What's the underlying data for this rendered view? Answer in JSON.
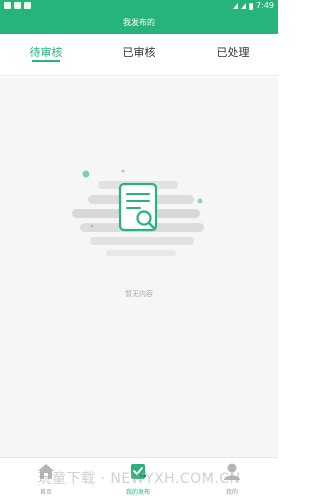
{
  "status": {
    "time": "7:49"
  },
  "header": {
    "title": "我发布的"
  },
  "tabs": [
    {
      "label": "待审核",
      "active": true
    },
    {
      "label": "已审核",
      "active": false
    },
    {
      "label": "已处理",
      "active": false
    }
  ],
  "empty": {
    "text": "暂无内容",
    "icon": "document-search-icon"
  },
  "tabbar": {
    "items": [
      {
        "label": "首页",
        "icon": "home-icon"
      },
      {
        "label": "我的发布",
        "icon": "publish-icon"
      },
      {
        "label": "我的",
        "icon": "user-icon"
      }
    ]
  },
  "watermark": "玩童下载 · NEWYXH.COM.CN",
  "colors": {
    "accent": "#27b47b"
  }
}
